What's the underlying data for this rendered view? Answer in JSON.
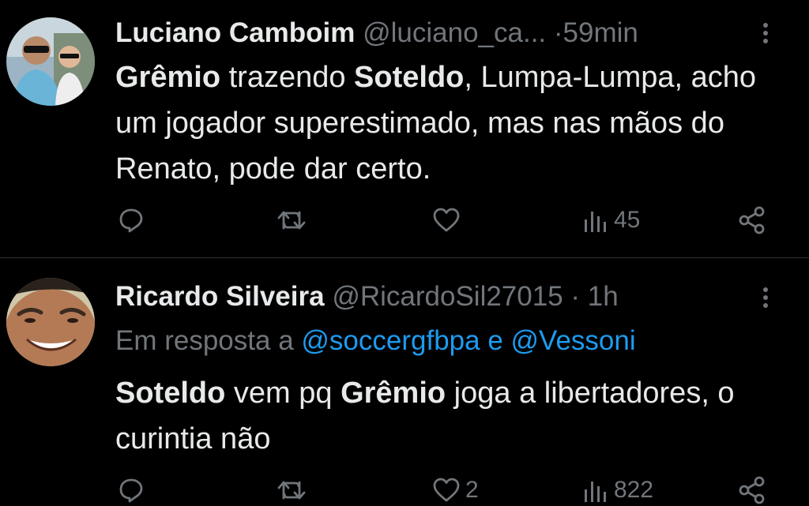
{
  "colors": {
    "background": "#000000",
    "primary_text": "#e7e9ea",
    "secondary_text": "#71767b",
    "link": "#1d9bf0",
    "divider": "#2f3336"
  },
  "tweets": [
    {
      "display_name": "Luciano Camboim",
      "handle": "@luciano_ca...",
      "separator": "·",
      "time": "59min",
      "text_segments": [
        {
          "text": "Grêmio",
          "bold": true
        },
        {
          "text": " trazendo ",
          "bold": false
        },
        {
          "text": "Soteldo",
          "bold": true
        },
        {
          "text": ", Lumpa-Lumpa, acho um jogador superestimado, mas nas mãos do Renato, pode dar certo.",
          "bold": false
        }
      ],
      "actions": {
        "reply_icon": "reply-icon",
        "retweet_icon": "retweet-icon",
        "like_icon": "like-icon",
        "like_count": "",
        "views_icon": "views-icon",
        "views_count": "45",
        "share_icon": "share-icon"
      }
    },
    {
      "display_name": "Ricardo Silveira",
      "handle": "@RicardoSil27015",
      "separator": "·",
      "time": "1h",
      "reply_prefix": "Em resposta a ",
      "reply_mention_1": "@soccergfbpa",
      "reply_conjunction": " e ",
      "reply_mention_2": "@Vessoni",
      "text_segments": [
        {
          "text": "Soteldo",
          "bold": true
        },
        {
          "text": " vem pq ",
          "bold": false
        },
        {
          "text": "Grêmio",
          "bold": true
        },
        {
          "text": " joga a libertadores, o curintia não",
          "bold": false
        }
      ],
      "actions": {
        "reply_icon": "reply-icon",
        "retweet_icon": "retweet-icon",
        "like_icon": "like-icon",
        "like_count": "2",
        "views_icon": "views-icon",
        "views_count": "822",
        "share_icon": "share-icon"
      }
    }
  ]
}
